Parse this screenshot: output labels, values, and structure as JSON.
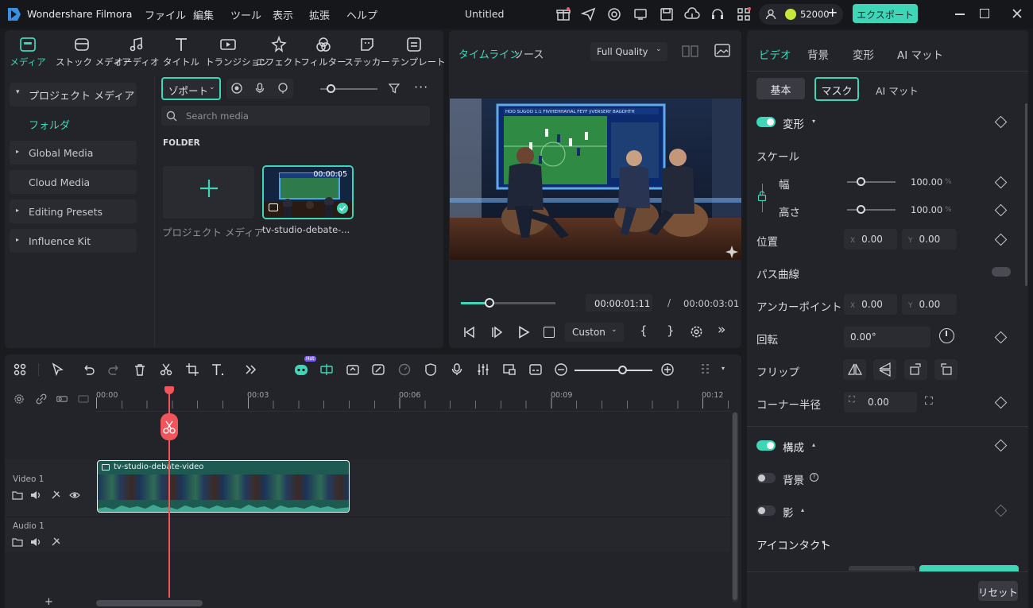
{
  "app": {
    "name": "Wondershare Filmora",
    "document_title": "Untitled",
    "credits": "52000",
    "export_label": "エクスポート"
  },
  "menu": [
    "ファイル",
    "編集",
    "ツール",
    "表示",
    "拡張",
    "ヘルプ"
  ],
  "tool_tabs": [
    {
      "label": "メディア",
      "icon": "media-icon",
      "active": true
    },
    {
      "label": "ストック メディア",
      "icon": "stock-media-icon"
    },
    {
      "label": "オーディオ",
      "icon": "audio-icon"
    },
    {
      "label": "タイトル",
      "icon": "title-icon"
    },
    {
      "label": "トランジション",
      "icon": "transition-icon"
    },
    {
      "label": "エフェクト",
      "icon": "effect-icon"
    },
    {
      "label": "フィルター",
      "icon": "filter-icon"
    },
    {
      "label": "ステッカー",
      "icon": "sticker-icon"
    },
    {
      "label": "テンプレート",
      "icon": "template-icon"
    }
  ],
  "media_sidebar": {
    "project_media": "プロジェクト メディア",
    "folder": "フォルダ",
    "items": [
      "Global Media",
      "Cloud Media",
      "Editing Presets",
      "Influence Kit"
    ]
  },
  "media_browser": {
    "import_label": "ゾポート",
    "search_placeholder": "Search media",
    "folder_header": "FOLDER",
    "add_tile_label": "プロジェクト メディア",
    "clip_name": "tv-studio-debate-...",
    "clip_duration": "00:00:05"
  },
  "player": {
    "tab_timeline": "タイムライン",
    "tab_source": "ソース",
    "quality": "Full Quality",
    "current_time": "00:00:01:11",
    "separator": "/",
    "total_time": "00:00:03:01",
    "progress": 0.3,
    "custom_label": "Custon",
    "broadcast_text": "HOO SUGOO 1:1 FIVIHEHHAYIAL FEYF ÿVERSERY BAGDHTH"
  },
  "properties": {
    "tabs": [
      "ビデオ",
      "背景",
      "変形",
      "AI マット"
    ],
    "subtabs": [
      "基本",
      "マスク",
      "AI マット"
    ],
    "transform_section": "変形",
    "scale_label": "スケール",
    "width_label": "幅",
    "width_value": "100.00",
    "height_label": "高さ",
    "height_value": "100.00",
    "percent": "%",
    "position_label": "位置",
    "pos_x_label": "X",
    "pos_x": "0.00",
    "pos_y_label": "Y",
    "pos_y": "0.00",
    "path_curve_label": "パス曲線",
    "anchor_label": "アンカーポイント",
    "anchor_x": "0.00",
    "anchor_y": "0.00",
    "rotation_label": "回転",
    "rotation_value": "0.00°",
    "flip_label": "フリップ",
    "corner_label": "コーナー半径",
    "corner_value": "0.00",
    "compose_section": "構成",
    "background_label": "背景",
    "shadow_label": "影",
    "eye_contact_label": "アイコンタクト",
    "reset_label": "リセット"
  },
  "timeline": {
    "ruler": [
      "00:00",
      "00:03",
      "00:06",
      "00:09",
      "00:12"
    ],
    "video_track": "Video 1",
    "audio_track": "Audio 1",
    "clip_title": "tv-studio-debate-video",
    "ai_badge": "Hot"
  },
  "colors": {
    "accent": "#3fd6b7",
    "playhead": "#f2545b"
  }
}
